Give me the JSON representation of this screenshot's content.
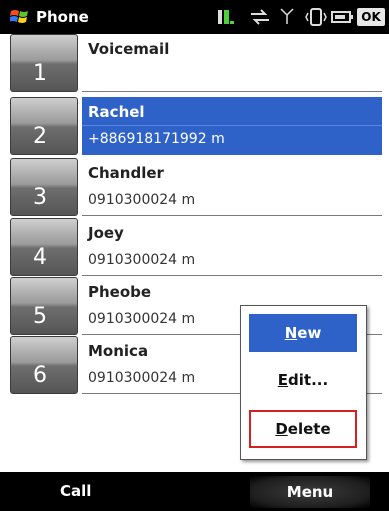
{
  "titlebar": {
    "title": "Phone",
    "ok_label": "OK",
    "icons": [
      "windows-logo-icon",
      "battery-charge-icon",
      "data-transfer-icon",
      "signal-icon",
      "vibrate-icon",
      "battery-icon"
    ]
  },
  "speed_dial": [
    {
      "slot": "1",
      "name": "Voicemail",
      "phone": ""
    },
    {
      "slot": "2",
      "name": "Rachel",
      "phone": "+886918171992 m",
      "selected": true
    },
    {
      "slot": "3",
      "name": "Chandler",
      "phone": "0910300024 m"
    },
    {
      "slot": "4",
      "name": "Joey",
      "phone": "0910300024 m"
    },
    {
      "slot": "5",
      "name": "Pheobe",
      "phone": "0910300024 m"
    },
    {
      "slot": "6",
      "name": "Monica",
      "phone": "0910300024 m"
    }
  ],
  "popup_menu": {
    "new_first": "N",
    "new_rest": "ew",
    "edit_first": "E",
    "edit_rest": "dit...",
    "delete_first": "D",
    "delete_rest": "elete"
  },
  "softkeys": {
    "left": "Call",
    "right": "Menu"
  },
  "colors": {
    "selection": "#2f62c9",
    "highlight_border": "#d42020"
  }
}
